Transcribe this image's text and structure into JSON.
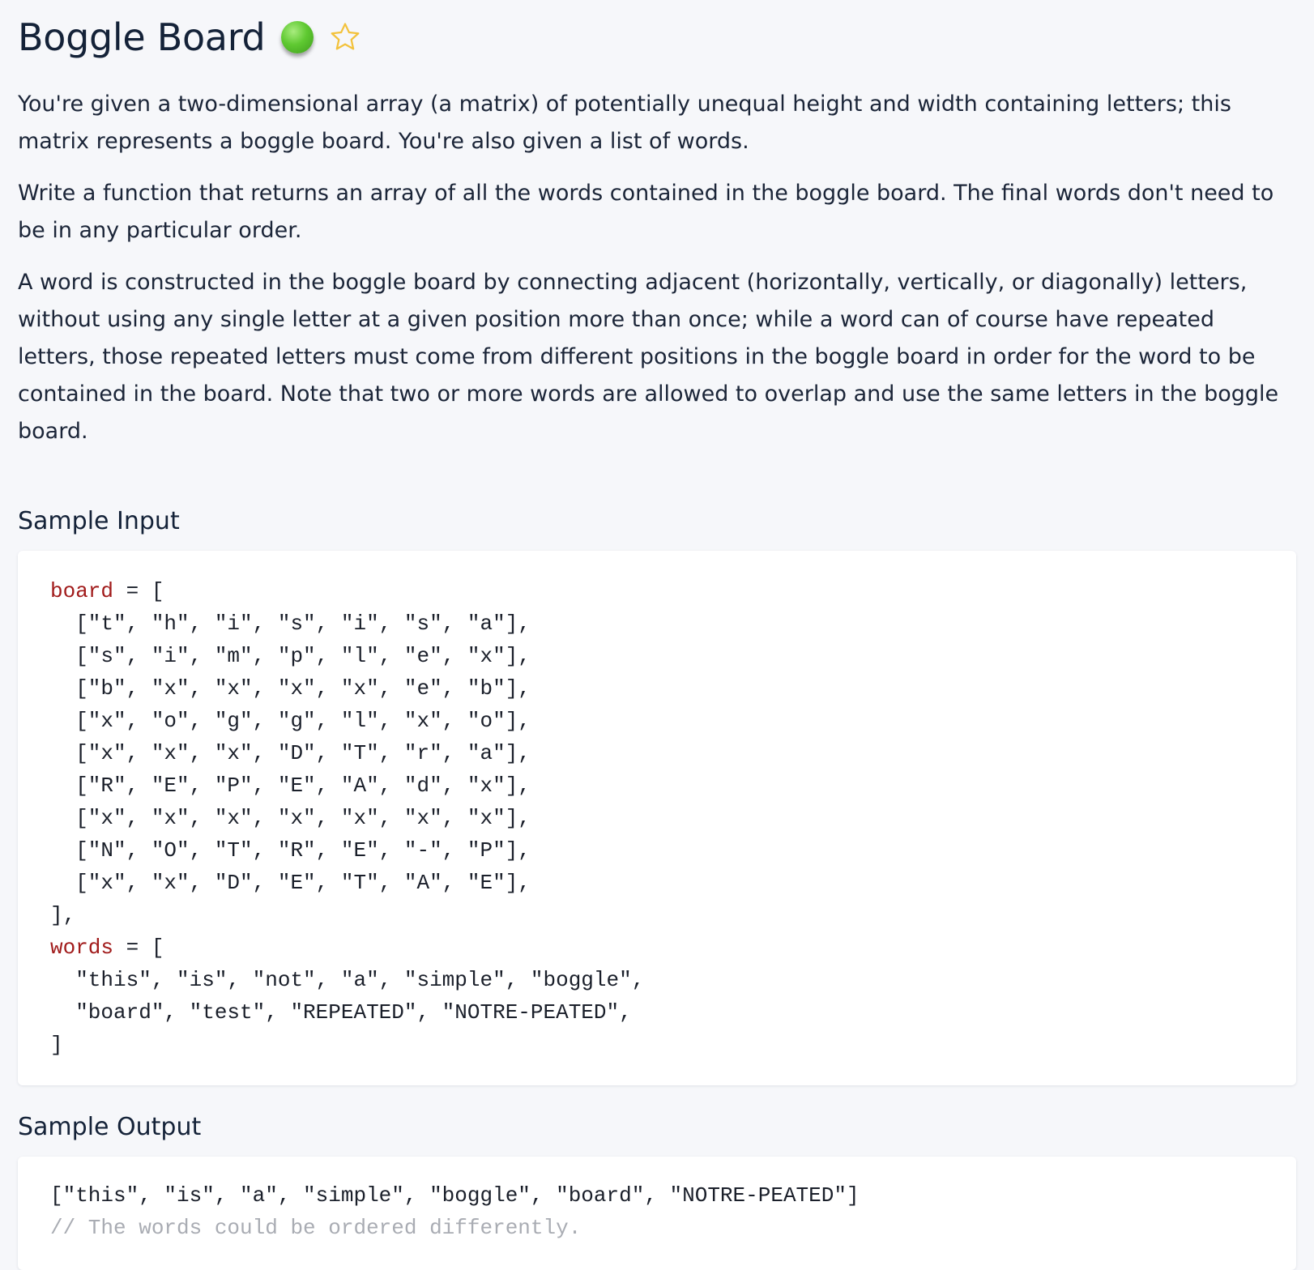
{
  "title": "Boggle Board",
  "description": [
    "You're given a two-dimensional array (a matrix) of potentially unequal height and width containing letters; this matrix represents a boggle board. You're also given a list of words.",
    "Write a function that returns an array of all the words contained in the boggle board. The final words don't need to be in any particular order.",
    "A word is constructed in the boggle board by connecting adjacent (horizontally, vertically, or diagonally) letters, without using any single letter at a given position more than once; while a word can of course have repeated letters, those repeated letters must come from different positions in the boggle board in order for the word to be contained in the board. Note that two or more words are allowed to overlap and use the same letters in the boggle board."
  ],
  "sample_input": {
    "heading": "Sample Input",
    "board_var": "board",
    "board_open": " = [",
    "board_rows": [
      "  [\"t\", \"h\", \"i\", \"s\", \"i\", \"s\", \"a\"],",
      "  [\"s\", \"i\", \"m\", \"p\", \"l\", \"e\", \"x\"],",
      "  [\"b\", \"x\", \"x\", \"x\", \"x\", \"e\", \"b\"],",
      "  [\"x\", \"o\", \"g\", \"g\", \"l\", \"x\", \"o\"],",
      "  [\"x\", \"x\", \"x\", \"D\", \"T\", \"r\", \"a\"],",
      "  [\"R\", \"E\", \"P\", \"E\", \"A\", \"d\", \"x\"],",
      "  [\"x\", \"x\", \"x\", \"x\", \"x\", \"x\", \"x\"],",
      "  [\"N\", \"O\", \"T\", \"R\", \"E\", \"-\", \"P\"],",
      "  [\"x\", \"x\", \"D\", \"E\", \"T\", \"A\", \"E\"],"
    ],
    "board_close": "],",
    "words_var": "words",
    "words_open": " = [",
    "words_rows": [
      "  \"this\", \"is\", \"not\", \"a\", \"simple\", \"boggle\",",
      "  \"board\", \"test\", \"REPEATED\", \"NOTRE-PEATED\","
    ],
    "words_close": "]"
  },
  "sample_output": {
    "heading": "Sample Output",
    "result": "[\"this\", \"is\", \"a\", \"simple\", \"boggle\", \"board\", \"NOTRE-PEATED\"]",
    "comment": "// The words could be ordered differently."
  },
  "colors": {
    "background": "#f6f7fa",
    "status_dot": "#5fc931",
    "star": "#f3c23c",
    "variable": "#a11b1b",
    "comment": "#a9acb3"
  },
  "icons": {
    "status": "green-status-dot",
    "favorite": "star-outline-icon"
  }
}
